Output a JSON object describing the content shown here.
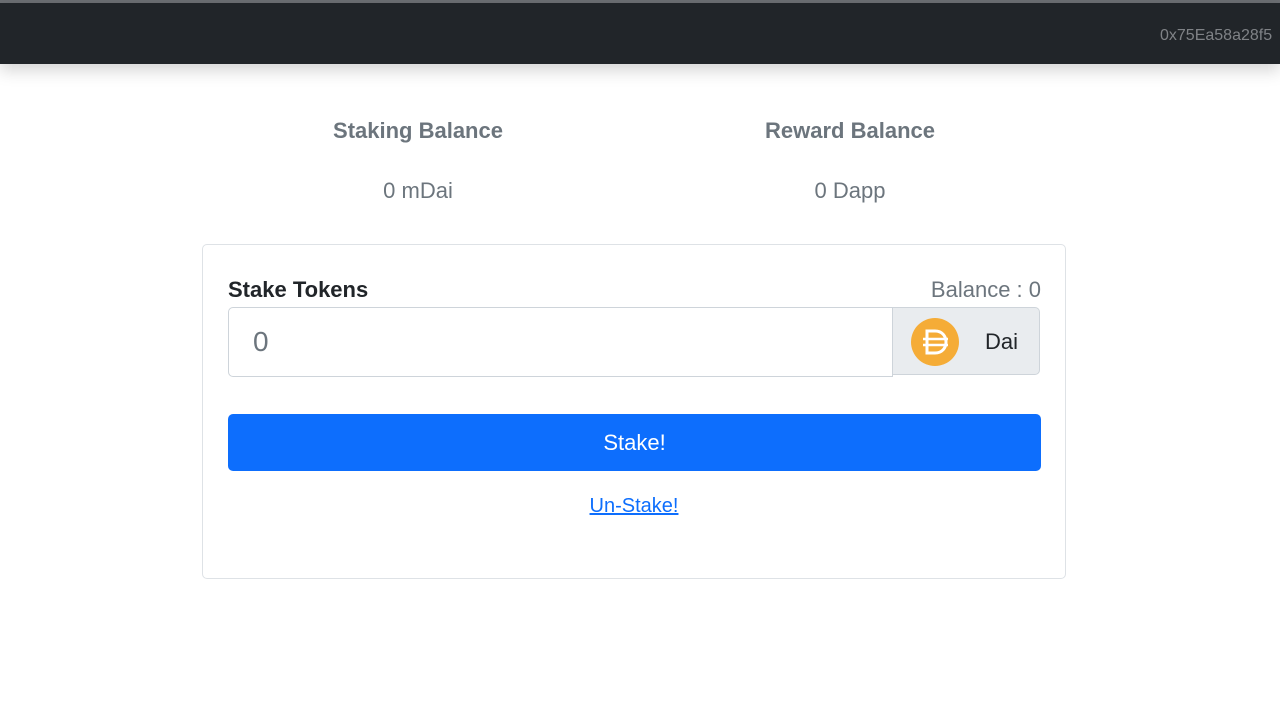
{
  "navbar": {
    "account": "0x75Ea58a28f5"
  },
  "stats": {
    "staking_title": "Staking Balance",
    "staking_value": "0 mDai",
    "reward_title": "Reward Balance",
    "reward_value": "0 Dapp"
  },
  "stake_form": {
    "title": "Stake Tokens",
    "balance": "Balance : 0",
    "amount_placeholder": "0",
    "token_label": "Dai",
    "token_icon": "dai-icon",
    "stake_label": "Stake!",
    "unstake_label": "Un-Stake!"
  },
  "colors": {
    "navbar_bg": "#212529",
    "primary": "#0d6efd",
    "dai": "#f5ac37",
    "muted": "#6c757d"
  }
}
